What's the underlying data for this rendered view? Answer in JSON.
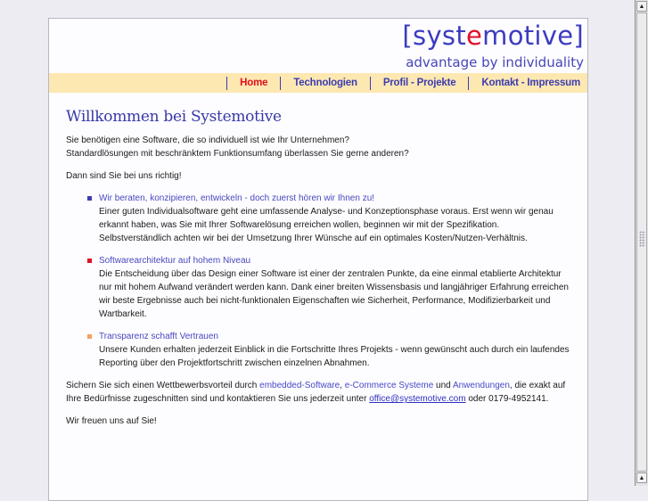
{
  "header": {
    "logo_prefix": "[syst",
    "logo_accent": "e",
    "logo_suffix": "motive]",
    "tagline": "advantage by individuality"
  },
  "nav": [
    {
      "label": "Home",
      "active": true
    },
    {
      "label": "Technologien"
    },
    {
      "label": "Profil - Projekte"
    },
    {
      "label": "Kontakt - Impressum"
    }
  ],
  "main": {
    "title": "Willkommen bei Systemotive",
    "intro_1": "Sie benötigen eine Software, die so individuell ist wie Ihr Unternehmen?",
    "intro_2": "Standardlösungen mit beschränktem Funktionsumfang überlassen Sie gerne anderen?",
    "intro_3": "Dann sind Sie bei uns richtig!",
    "features": [
      {
        "title": "Wir beraten, konzipieren, entwickeln - doch zuerst hören wir Ihnen zu!",
        "color": "#3c3cb0",
        "text": "Einer guten Individualsoftware geht eine umfassende Analyse- und Konzeptionsphase voraus. Erst wenn wir genau erkannt haben, was Sie mit Ihrer Softwarelösung erreichen wollen, beginnen wir mit der Spezifikation. Selbstverständlich achten wir bei der Umsetzung Ihrer Wünsche auf ein optimales Kosten/Nutzen-Verhältnis."
      },
      {
        "title": "Softwarearchitektur auf hohem Niveau",
        "color": "#e0102a",
        "text": "Die Entscheidung über das Design einer Software ist einer der zentralen Punkte, da eine einmal etablierte Architektur nur mit hohem Aufwand verändert werden kann. Dank einer breiten Wissensbasis und langjähriger Erfahrung erreichen wir beste Ergebnisse auch bei nicht-funktionalen Eigenschaften wie Sicherheit, Performance, Modifizierbarkeit und Wartbarkeit."
      },
      {
        "title": "Transparenz schafft Vertrauen",
        "color": "#f5a060",
        "text": "Unsere Kunden erhalten jederzeit Einblick in die Fortschritte Ihres Projekts - wenn gewünscht auch durch ein laufendes Reporting über den Projektfortschritt zwischen einzelnen Abnahmen."
      }
    ],
    "closing": {
      "t1": "Sichern Sie sich einen Wettbewerbsvorteil durch ",
      "link1": "embedded-Software",
      "t2": ", ",
      "link2": "e-Commerce Systeme",
      "t3": " und ",
      "link3": "Anwendungen",
      "t4": ", die exakt auf Ihre Bedürfnisse zugeschnitten sind und kontaktieren Sie uns jederzeit unter ",
      "email": "office@systemotive.com",
      "t5": " oder 0179-4952141."
    },
    "farewell": "Wir freuen uns auf Sie!"
  }
}
